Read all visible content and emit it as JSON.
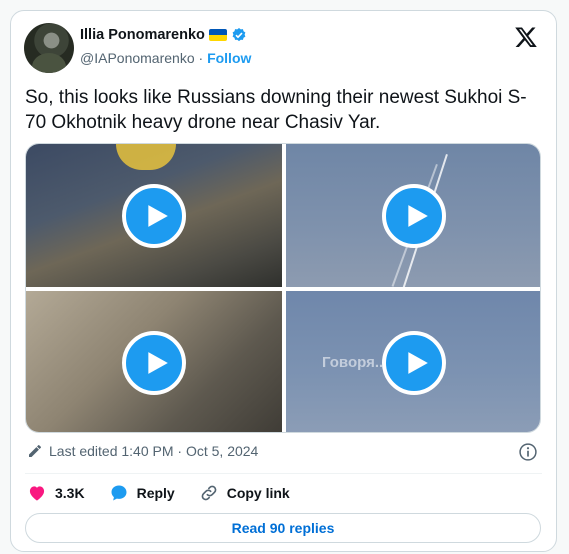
{
  "author": {
    "name": "Illia Ponomarenko",
    "handle": "@IAPonomarenko",
    "separator": "·",
    "follow_label": "Follow"
  },
  "tweet": {
    "text": "So, this looks like Russians downing their newest Sukhoi S-70 Okhotnik heavy drone near Chasiv Yar."
  },
  "media": {
    "videos": [
      {
        "id": "video-1"
      },
      {
        "id": "video-2"
      },
      {
        "id": "video-3"
      },
      {
        "id": "video-4",
        "watermark": "Говоря... пер ✚"
      }
    ]
  },
  "meta": {
    "edited_text": "Last edited 1:40 PM · Oct 5, 2024"
  },
  "actions": {
    "like_count": "3.3K",
    "reply_label": "Reply",
    "copy_link_label": "Copy link"
  },
  "replies_button": "Read 90 replies",
  "colors": {
    "accent": "#1d9bf0",
    "like": "#f91880",
    "link": "#006fd6"
  }
}
